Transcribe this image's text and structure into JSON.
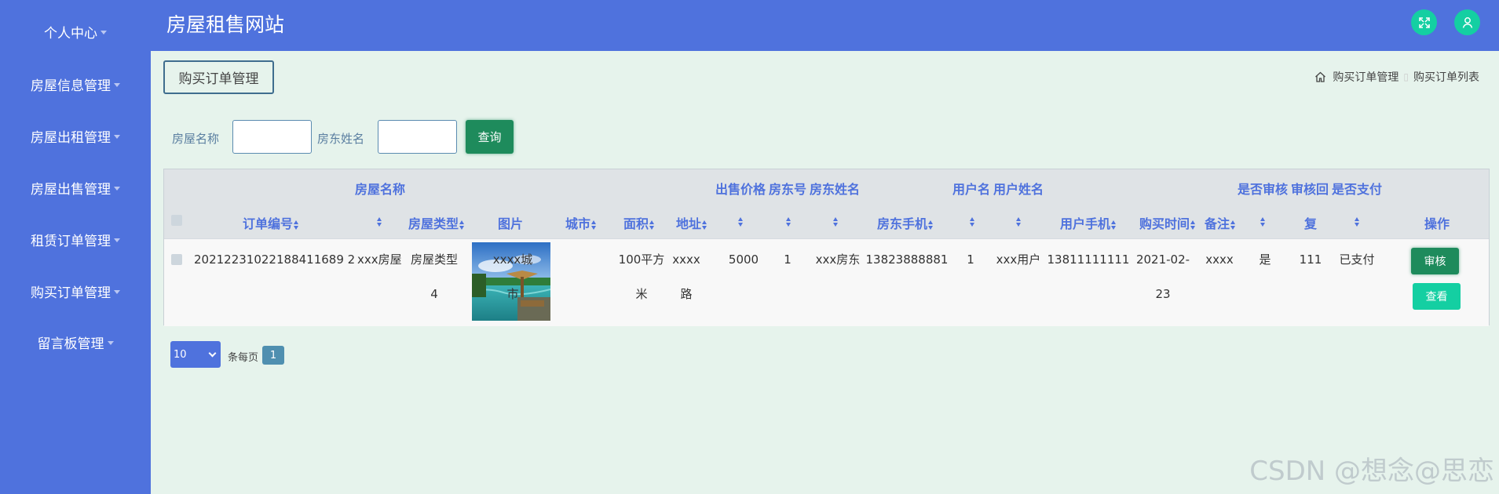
{
  "sidebar": {
    "items": [
      {
        "label": "个人中心"
      },
      {
        "label": "房屋信息管理"
      },
      {
        "label": "房屋出租管理"
      },
      {
        "label": "房屋出售管理"
      },
      {
        "label": "租赁订单管理"
      },
      {
        "label": "购买订单管理"
      },
      {
        "label": "留言板管理"
      }
    ]
  },
  "header": {
    "title": "房屋租售网站",
    "fullscreen_icon": "fullscreen-icon",
    "user_icon": "user-icon"
  },
  "page": {
    "title_button": "购买订单管理",
    "breadcrumb": [
      "购买订单管理",
      "购买订单列表"
    ]
  },
  "search": {
    "house_name_label": "房屋名称",
    "landlord_name_label": "房东姓名",
    "house_name_value": "",
    "landlord_name_value": "",
    "query_label": "查询"
  },
  "table": {
    "headers_top": {
      "house_name": "房屋名称",
      "sale_price": "出售价格",
      "room_no": "房东号",
      "landlord_name": "房东姓名",
      "username": "用户名",
      "user_realname": "用户姓名",
      "is_review": "是否审核",
      "review_reply": "审核回",
      "is_paid": "是否支付"
    },
    "headers_bottom": {
      "order_no": "订单编号",
      "house_type": "房屋类型",
      "image": "图片",
      "city": "城市",
      "area": "面积",
      "address": "地址",
      "landlord_phone": "房东手机",
      "user_phone": "用户手机",
      "purchase_time": "购买时间",
      "remark": "备注",
      "reply": "复",
      "actions": "操作"
    },
    "rows": [
      {
        "order_no": "20212231022188411689 2",
        "house_name": "xxx房屋",
        "house_type_1": "房屋类型",
        "house_type_2": "4",
        "city_1": "xxxx城",
        "city_2": "市",
        "area_1": "100平方",
        "area_2": "米",
        "address_1": "xxxx",
        "address_2": "路",
        "sale_price": "5000",
        "room_no": "1",
        "landlord_name": "xxx房东",
        "landlord_phone": "13823888881",
        "username": "1",
        "user_realname": "xxx用户",
        "user_phone": "13811111111",
        "purchase_time_1": "2021-02-",
        "purchase_time_2": "23",
        "remark": "xxxx",
        "is_review": "是",
        "review_reply": "111",
        "is_paid": "已支付",
        "review_btn": "审核",
        "view_btn": "查看"
      }
    ]
  },
  "pagination": {
    "page_size": "10",
    "per_page_label": "条每页",
    "current_page": "1"
  },
  "watermark": "CSDN @想念@思恋",
  "colors": {
    "sidebar": "#4f72dd",
    "accent": "#14cfa2",
    "query_button": "#1e8b5c",
    "background": "#e6f3ec"
  }
}
